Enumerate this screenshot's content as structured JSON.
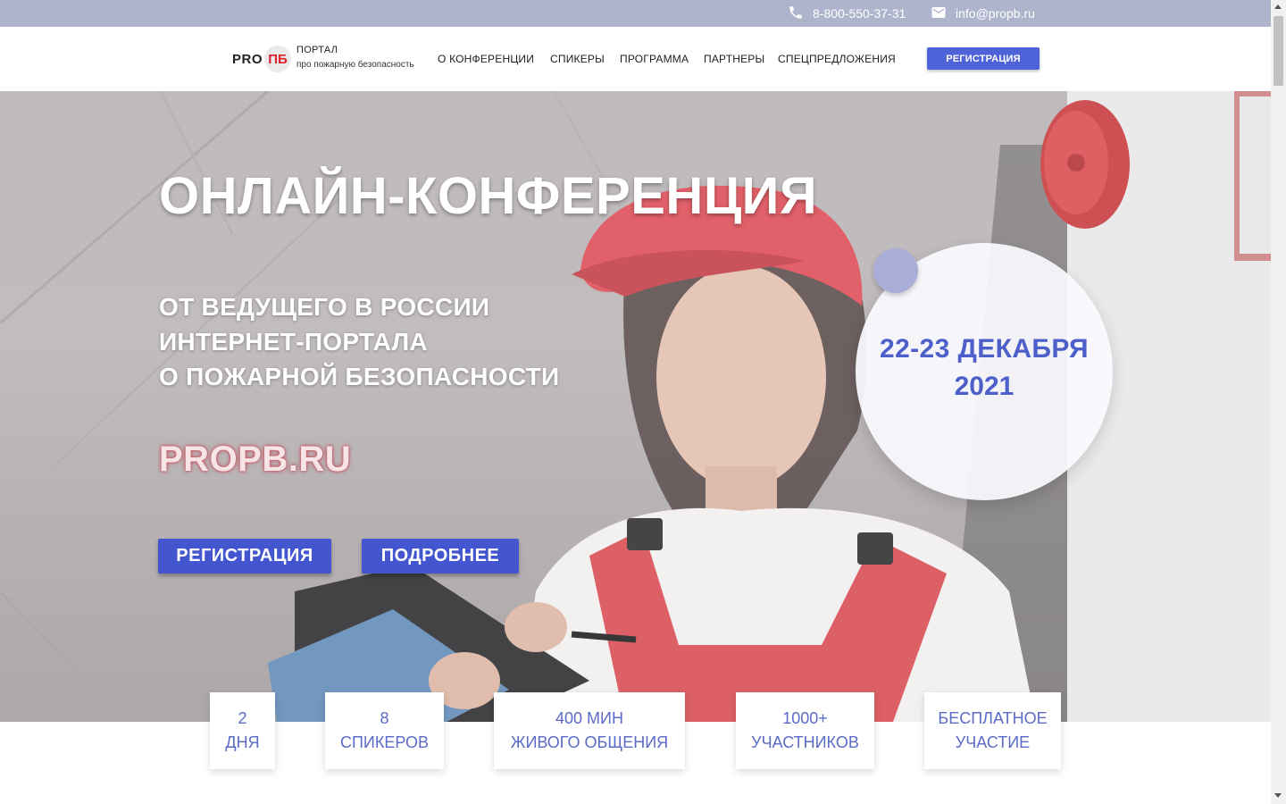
{
  "topbar": {
    "phone": "8-800-550-37-31",
    "email": "info@propb.ru",
    "phone_icon": "phone-icon",
    "email_icon": "mail-icon"
  },
  "header": {
    "logo_pro": "PRO",
    "logo_pb": "ПБ",
    "logo_line1": "ПОРТАЛ",
    "logo_line2": "про пожарную безопасность",
    "nav": [
      {
        "label": "О КОНФЕРЕНЦИИ"
      },
      {
        "label": "СПИКЕРЫ"
      },
      {
        "label": "ПРОГРАММА"
      },
      {
        "label": "ПАРТНЕРЫ"
      },
      {
        "label": "СПЕЦПРЕДЛОЖЕНИЯ"
      }
    ],
    "register_label": "РЕГИСТРАЦИЯ"
  },
  "hero": {
    "title": "ОНЛАЙН-КОНФЕРЕНЦИЯ",
    "subtitle_lines": [
      "ОТ ВЕДУЩЕГО В РОССИИ",
      "ИНТЕРНЕТ-ПОРТАЛА",
      "О ПОЖАРНОЙ БЕЗОПАСНОСТИ"
    ],
    "site": "PROPB.RU",
    "register_label": "РЕГИСТРАЦИЯ",
    "more_label": "ПОДРОБНЕЕ",
    "date_line1": "22-23 ДЕКАБРЯ",
    "date_line2": "2021"
  },
  "stats": [
    {
      "line1": "2",
      "line2": "ДНЯ"
    },
    {
      "line1": "8",
      "line2": "СПИКЕРОВ"
    },
    {
      "line1": "400 МИН",
      "line2": "ЖИВОГО ОБЩЕНИЯ"
    },
    {
      "line1": "1000+",
      "line2": "УЧАСТНИКОВ"
    },
    {
      "line1": "БЕСПЛАТНОЕ",
      "line2": "УЧАСТИЕ"
    }
  ],
  "colors": {
    "accent": "#4f63d8",
    "topbar": "#aeb4cc",
    "date_text": "#4d5fc8",
    "stat_text": "#5b6bc7"
  }
}
